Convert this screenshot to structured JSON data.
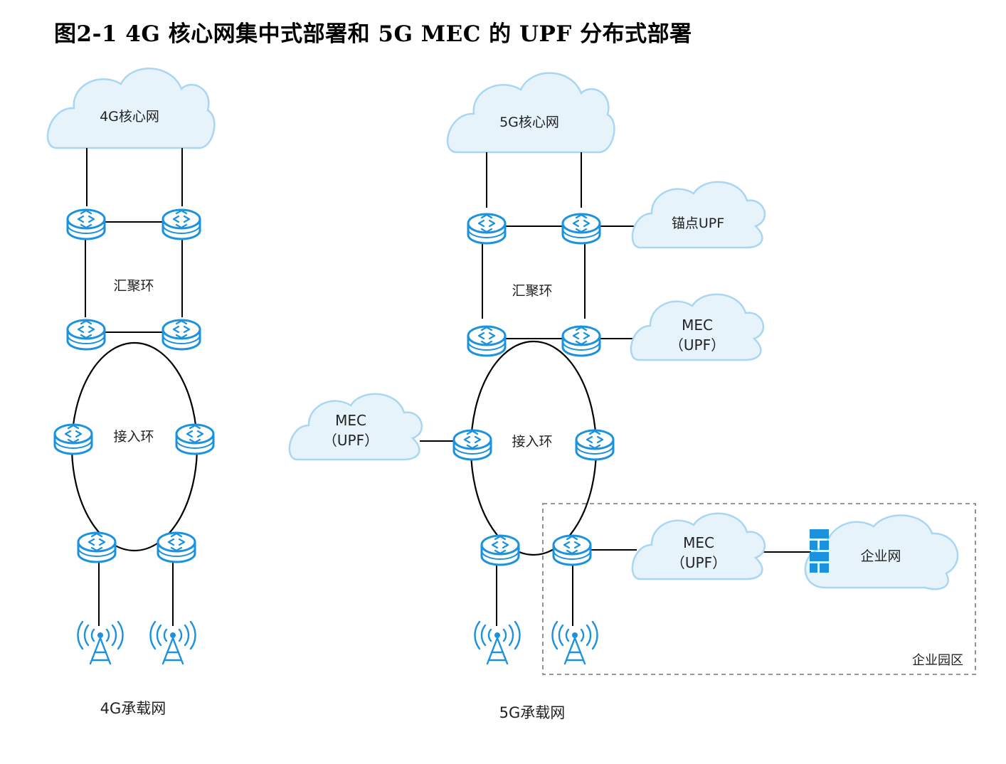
{
  "title": "图2-1  4G 核心网集中式部署和 5G MEC 的 UPF 分布式部署",
  "left": {
    "core": "4G核心网",
    "agg_ring": "汇聚环",
    "access_ring": "接入环",
    "bearer": "4G承载网"
  },
  "right": {
    "core": "5G核心网",
    "anchor_upf": "锚点UPF",
    "agg_ring": "汇聚环",
    "access_ring": "接入环",
    "bearer": "5G承载网",
    "mec_line1": "MEC",
    "mec_line2": "（UPF）",
    "enterprise_net": "企业网",
    "enterprise_park": "企业园区"
  },
  "colors": {
    "device": "#1b92dd",
    "cloud_fill": "#e7f3fb",
    "cloud_stroke": "#a9d6f2"
  }
}
